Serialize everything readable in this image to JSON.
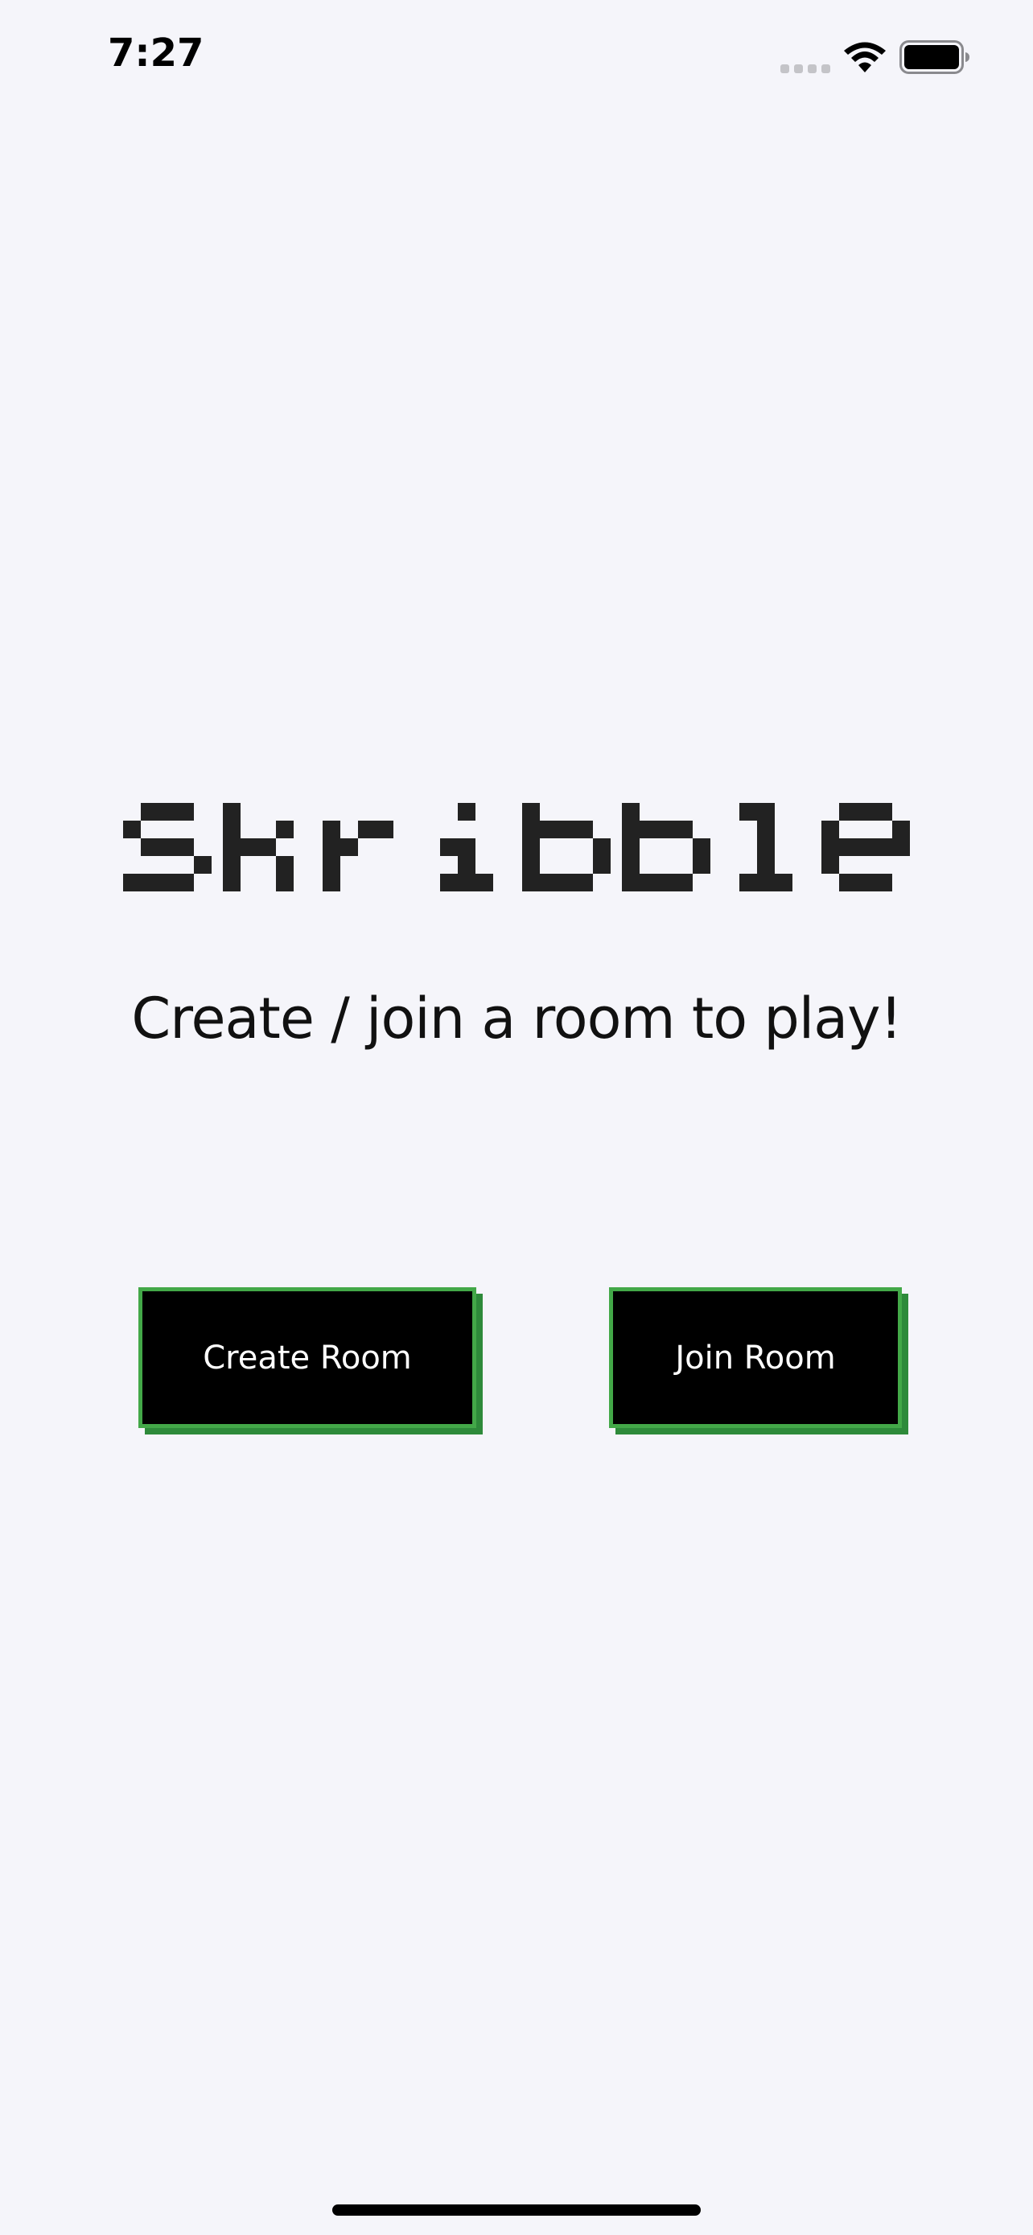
{
  "status_bar": {
    "time": "7:27",
    "icons": [
      "cellular-signal-icon",
      "wifi-icon",
      "battery-icon"
    ]
  },
  "main": {
    "title": "Skribble",
    "subtitle": "Create / join a room to play!"
  },
  "buttons": {
    "create_room_label": "Create Room",
    "join_room_label": "Join Room"
  },
  "colors": {
    "background": "#f5f5fa",
    "title": "#222222",
    "button_bg": "#000000",
    "button_border": "#43a848",
    "button_shadow": "#2e8a3a",
    "button_text": "#ffffff"
  }
}
